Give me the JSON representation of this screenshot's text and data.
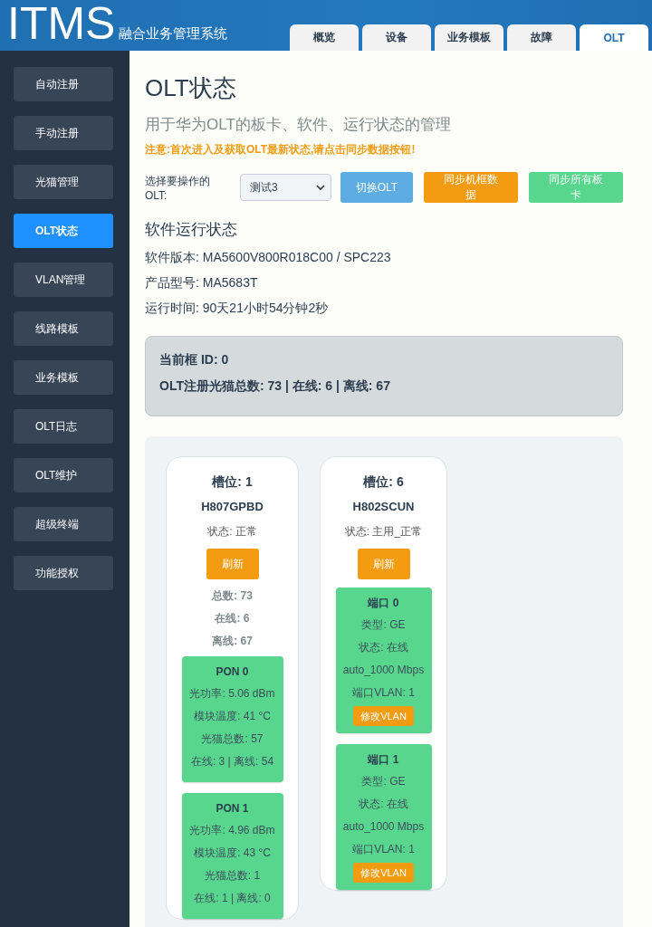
{
  "header": {
    "logo": "ITMS",
    "subtitle": "融合业务管理系统"
  },
  "tabs": [
    {
      "label": "概览",
      "selected": false
    },
    {
      "label": "设备",
      "selected": false
    },
    {
      "label": "业务模板",
      "selected": false
    },
    {
      "label": "故障",
      "selected": false
    },
    {
      "label": "OLT",
      "selected": true
    }
  ],
  "sidebar": {
    "items": [
      {
        "label": "自动注册",
        "selected": false
      },
      {
        "label": "手动注册",
        "selected": false
      },
      {
        "label": "光猫管理",
        "selected": false
      },
      {
        "label": "OLT状态",
        "selected": true
      },
      {
        "label": "VLAN管理",
        "selected": false
      },
      {
        "label": "线路模板",
        "selected": false
      },
      {
        "label": "业务模板",
        "selected": false
      },
      {
        "label": "OLT日志",
        "selected": false
      },
      {
        "label": "OLT维护",
        "selected": false
      },
      {
        "label": "超级终端",
        "selected": false
      },
      {
        "label": "功能授权",
        "selected": false
      }
    ]
  },
  "page": {
    "title": "OLT状态",
    "subtitle": "用于华为OLT的板卡、软件、运行状态的管理",
    "notice": "注意:首次进入及获取OLT最新状态,请点击同步数据按钮!"
  },
  "toolbar": {
    "select_label": "选择要操作的OLT:",
    "select_value": "测试3",
    "buttons": [
      {
        "label": "切换OLT",
        "kind": "switch"
      },
      {
        "label": "同步机框数据",
        "kind": "sync"
      },
      {
        "label": "同步所有板卡",
        "kind": "sync_all"
      }
    ]
  },
  "software": {
    "heading": "软件运行状态",
    "lines": [
      "软件版本: MA5600V800R018C00 / SPC223",
      "产品型号: MA5683T",
      "运行时间: 90天21小时54分钟2秒"
    ]
  },
  "frame": {
    "lines": [
      "当前框 ID: 0",
      "OLT注册光猫总数: 73 | 在线: 6 | 离线: 67"
    ]
  },
  "slots": [
    {
      "kind": "pon",
      "title": "槽位: 1",
      "model": "H807GPBD",
      "status": "状态: 正常",
      "refresh": "刷新",
      "stats": [
        "总数: 73",
        "在线: 6",
        "离线: 67"
      ],
      "ports": [
        {
          "title": "PON 0",
          "lines": [
            "光功率: 5.06 dBm",
            "模块温度: 41 °C",
            "光猫总数: 57",
            "在线: 3 | 离线: 54"
          ]
        },
        {
          "title": "PON 1",
          "lines": [
            "光功率: 4.96 dBm",
            "模块温度: 43 °C",
            "光猫总数: 1",
            "在线: 1 | 离线: 0"
          ]
        }
      ]
    },
    {
      "kind": "control",
      "title": "槽位: 6",
      "model": "H802SCUN",
      "status": "状态: 主用_正常",
      "refresh": "刷新",
      "ports": [
        {
          "title": "端口 0",
          "lines": [
            "类型: GE",
            "状态: 在线",
            "auto_1000 Mbps",
            "端口VLAN: 1"
          ],
          "action": "修改VLAN"
        },
        {
          "title": "端口 1",
          "lines": [
            "类型: GE",
            "状态: 在线",
            "auto_1000 Mbps",
            "端口VLAN: 1"
          ],
          "action": "修改VLAN"
        }
      ]
    }
  ]
}
